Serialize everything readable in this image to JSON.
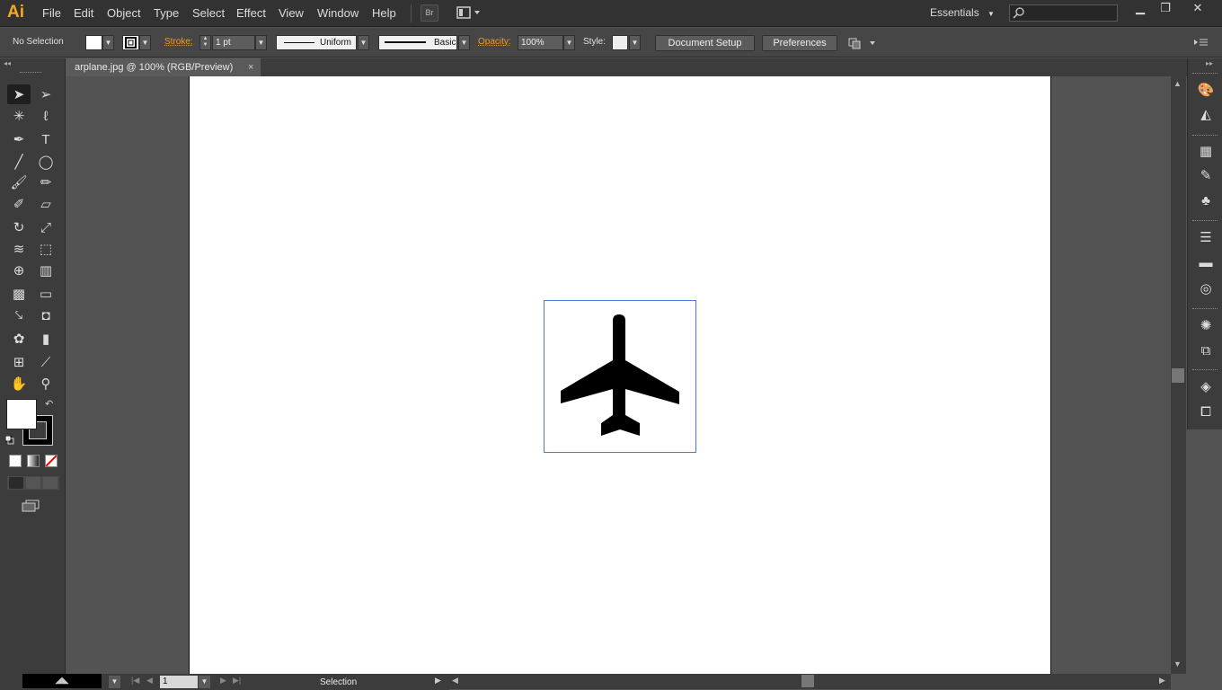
{
  "app": {
    "logo": "Ai",
    "menus": [
      "File",
      "Edit",
      "Object",
      "Type",
      "Select",
      "Effect",
      "View",
      "Window",
      "Help"
    ],
    "bridge_label": "Br",
    "workspace": "Essentials",
    "search_placeholder": "",
    "window_controls": {
      "minimize": "▁",
      "restore": "❐",
      "close": "✕"
    }
  },
  "control_bar": {
    "selection_status": "No Selection",
    "stroke_label": "Stroke:",
    "stroke_weight": "1 pt",
    "variable_width_profile": "Uniform",
    "brush_definition": "Basic",
    "opacity_label": "Opacity:",
    "opacity_value": "100%",
    "style_label": "Style:",
    "document_setup_label": "Document Setup",
    "preferences_label": "Preferences"
  },
  "document": {
    "tab_title": "arplane.jpg @ 100% (RGB/Preview)",
    "tab_close": "×"
  },
  "status_bar": {
    "page_number": "1",
    "current_tool": "Selection"
  },
  "colors": {
    "accent": "#f7a81b",
    "stroke_label": "#f39a21",
    "selection_bounds": "#4f7ad2",
    "panel_bg": "#3c3c3c",
    "canvas_bg": "#535353",
    "artboard": "#ffffff"
  },
  "tools": [
    "selection-tool-icon",
    "direct-selection-tool-icon",
    "magic-wand-tool-icon",
    "lasso-tool-icon",
    "pen-tool-icon",
    "type-tool-icon",
    "line-segment-tool-icon",
    "ellipse-tool-icon",
    "paintbrush-tool-icon",
    "pencil-tool-icon",
    "blob-brush-tool-icon",
    "eraser-tool-icon",
    "rotate-tool-icon",
    "scale-tool-icon",
    "width-tool-icon",
    "free-transform-tool-icon",
    "shape-builder-tool-icon",
    "perspective-grid-tool-icon",
    "mesh-tool-icon",
    "gradient-tool-icon",
    "eyedropper-tool-icon",
    "blend-tool-icon",
    "symbol-sprayer-tool-icon",
    "column-graph-tool-icon",
    "artboard-tool-icon",
    "slice-tool-icon",
    "hand-tool-icon",
    "zoom-tool-icon"
  ]
}
